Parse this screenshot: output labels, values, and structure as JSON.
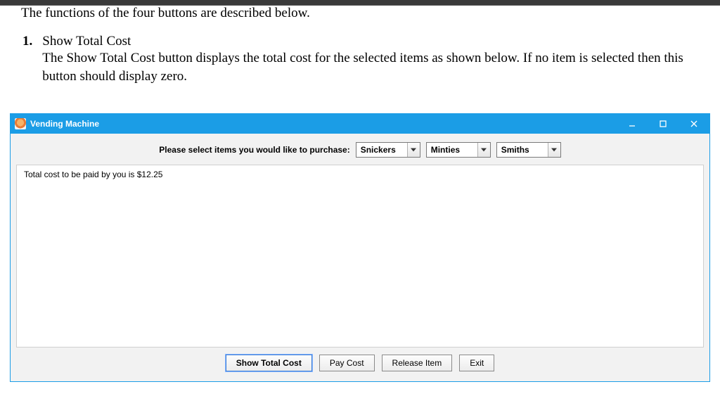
{
  "doc": {
    "intro": "The functions of the four buttons are described below.",
    "item_number": "1.",
    "item_title": "Show Total Cost",
    "item_desc": "The Show Total Cost button displays the total cost for the selected items as shown below. If no item is selected then this button should display zero."
  },
  "window": {
    "title": "Vending Machine",
    "select_label": "Please select items you would like to purchase:",
    "combos": [
      "Snickers",
      "Minties",
      "Smiths"
    ],
    "total_text": "Total cost to be paid by you is $12.25",
    "buttons": {
      "show_total": "Show Total Cost",
      "pay": "Pay Cost",
      "release": "Release Item",
      "exit": "Exit"
    }
  }
}
